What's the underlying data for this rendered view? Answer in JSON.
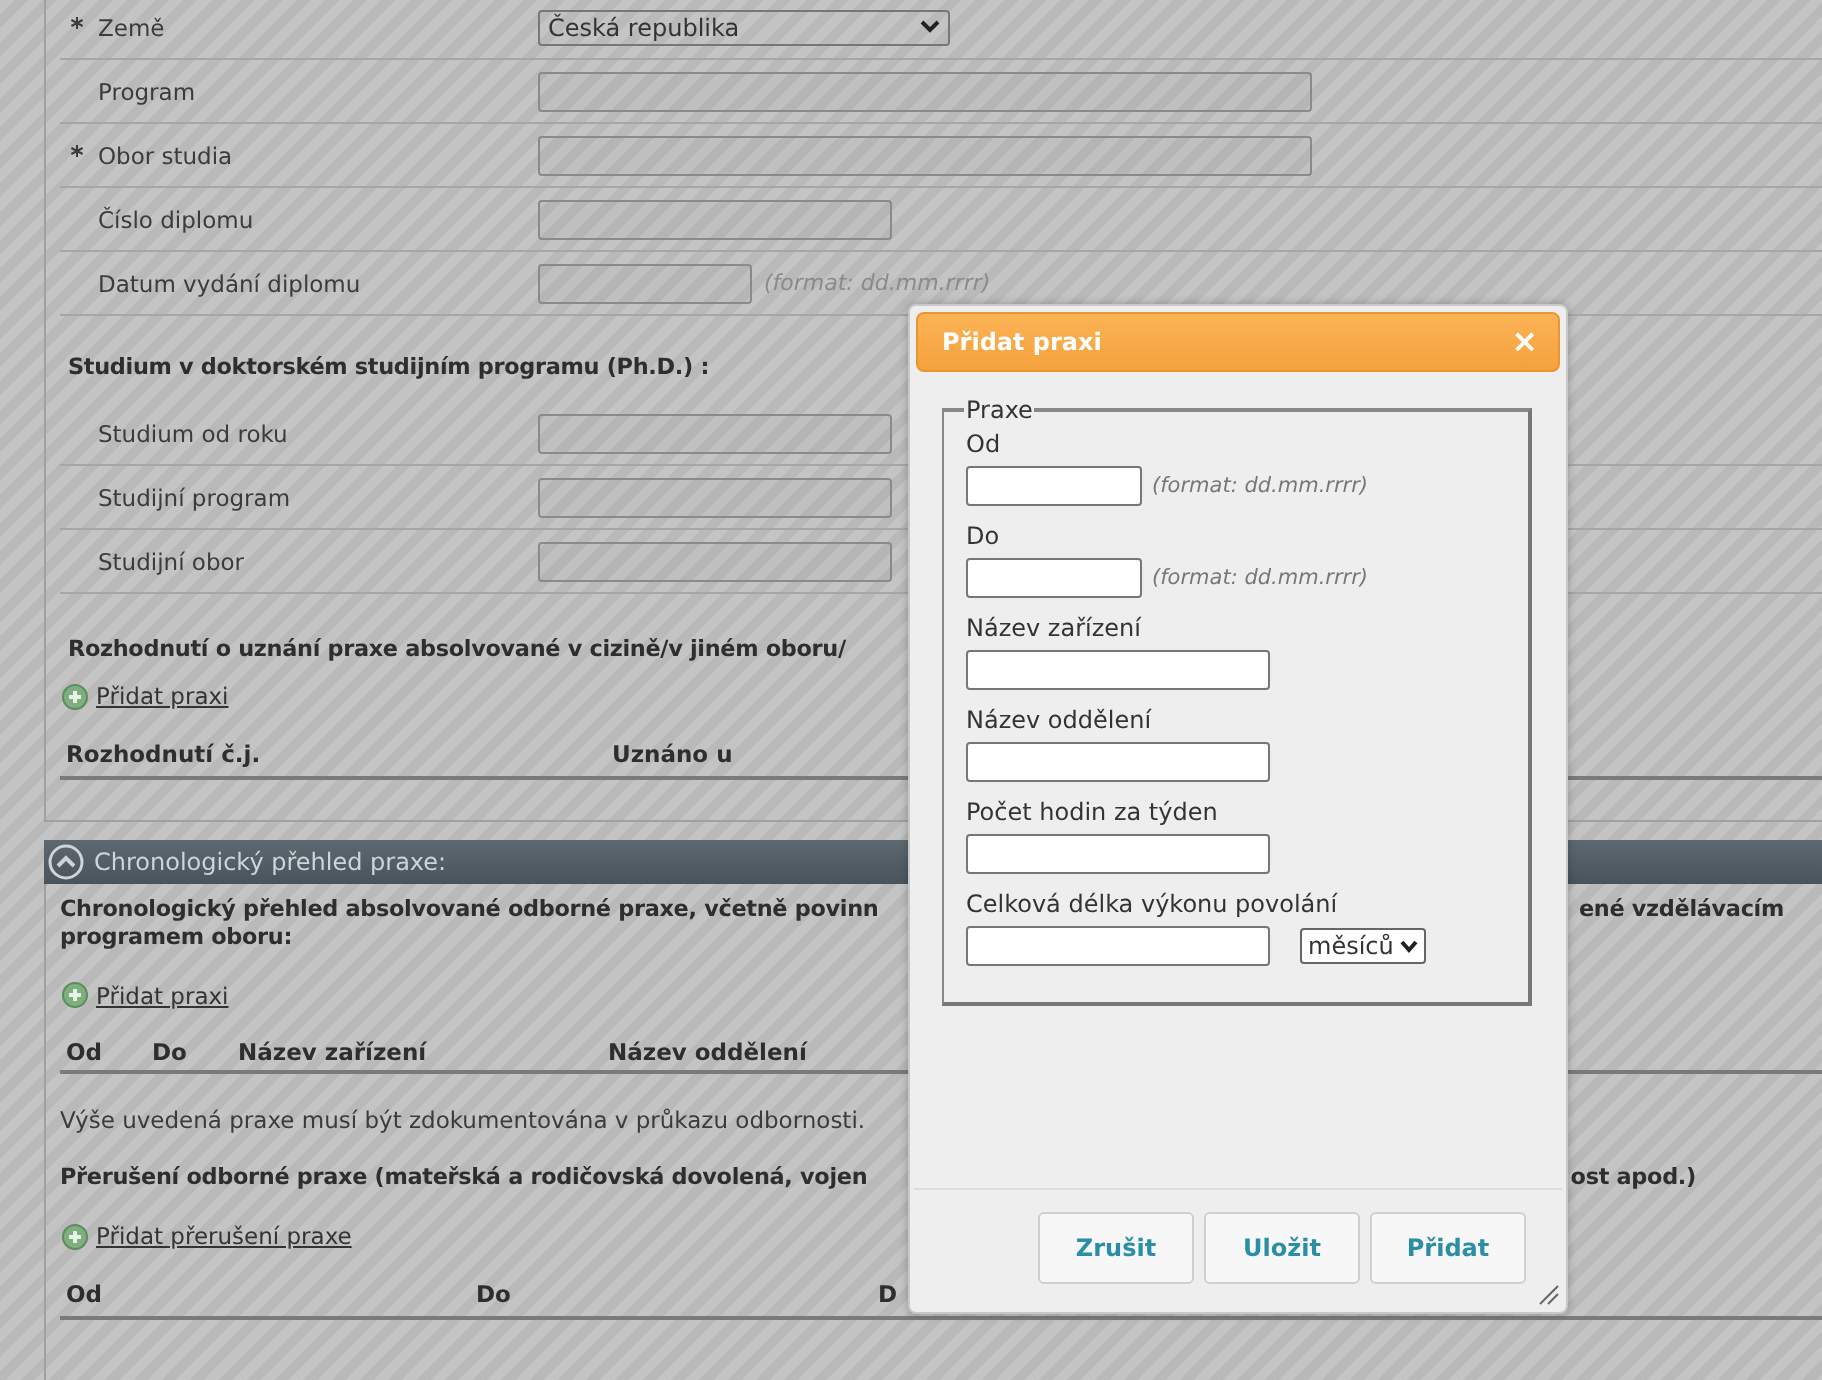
{
  "study_rows": [
    {
      "label": "Země",
      "required": true,
      "kind": "select",
      "value": "Česká republika"
    },
    {
      "label": "Program",
      "required": false,
      "kind": "wide"
    },
    {
      "label": "Obor studia",
      "required": true,
      "kind": "wide"
    },
    {
      "label": "Číslo diplomu",
      "required": false,
      "kind": "medium"
    },
    {
      "label": "Datum vydání diplomu",
      "required": false,
      "kind": "date",
      "hint": "(format: dd.mm.rrrr)"
    }
  ],
  "phd": {
    "heading": "Studium v doktorském studijním programu (Ph.D.) :",
    "rows": [
      {
        "label": "Studium od roku",
        "required": false,
        "kind": "medium"
      },
      {
        "label": "Studijní program",
        "required": false,
        "kind": "medium"
      },
      {
        "label": "Studijní obor",
        "required": false,
        "kind": "medium"
      }
    ]
  },
  "recognition": {
    "heading": "Rozhodnutí o uznání praxe absolvované v cizině/v jiném oboru/",
    "add_link": "Přidat praxi",
    "columns": [
      "Rozhodnutí č.j.",
      "Uznáno u"
    ]
  },
  "chronology": {
    "title": "Chronologický přehled praxe:",
    "expanded": true,
    "intro_left": "Chronologický přehled absolvované odborné praxe, včetně povinn",
    "intro_right": "ené vzdělávacím",
    "intro_line2": "programem oboru:",
    "add_link": "Přidat praxi",
    "columns": [
      "Od",
      "Do",
      "Název zařízení",
      "Název oddělení"
    ],
    "note": "Výše uvedená praxe musí být zdokumentována v průkazu odbornosti.",
    "interruption_left": "Přerušení odborné praxe (mateřská a rodičovská dovolená, vojen",
    "interruption_right": "ost apod.)",
    "interruption_link": "Přidat přerušení praxe",
    "interruption_columns": [
      "Od",
      "Do",
      "D"
    ]
  },
  "dialog": {
    "title": "Přidat praxi",
    "close": "×",
    "legend": "Praxe",
    "fields": [
      {
        "label": "Od",
        "kind": "date",
        "hint": "(format: dd.mm.rrrr)"
      },
      {
        "label": "Do",
        "kind": "date",
        "hint": "(format: dd.mm.rrrr)"
      },
      {
        "label": "Název zařízení",
        "kind": "text"
      },
      {
        "label": "Název oddělení",
        "kind": "text"
      },
      {
        "label": "Počet hodin za týden",
        "kind": "text"
      },
      {
        "label": "Celková délka výkonu povolání",
        "kind": "duration",
        "unit": "měsíců"
      }
    ],
    "buttons": [
      "Zrušit",
      "Uložit",
      "Přidat"
    ]
  }
}
